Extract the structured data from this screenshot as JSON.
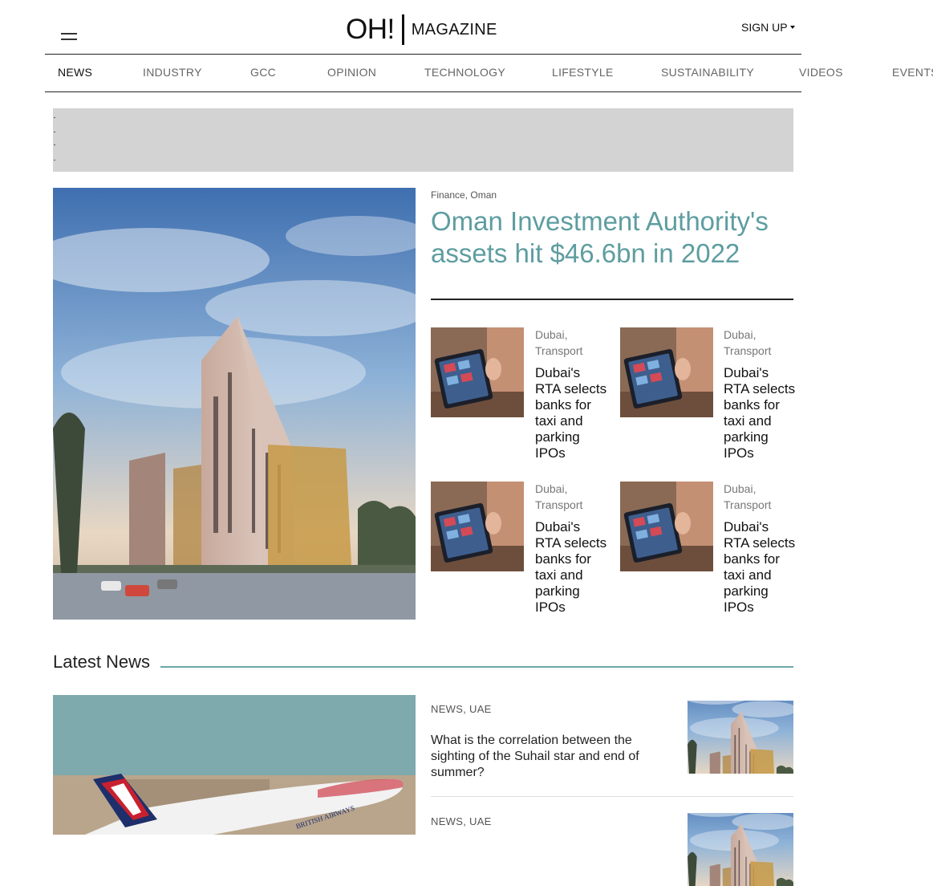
{
  "header": {
    "menu_icon": "hamburger-menu-icon",
    "logo_main": "OH!",
    "logo_sub": "MAGAZINE",
    "signup_label": "SIGN UP"
  },
  "nav": {
    "items": [
      {
        "label": "NEWS",
        "active": true
      },
      {
        "label": "INDUSTRY",
        "active": false
      },
      {
        "label": "GCC",
        "active": false
      },
      {
        "label": "OPINION",
        "active": false
      },
      {
        "label": "TECHNOLOGY",
        "active": false
      },
      {
        "label": "LIFESTYLE",
        "active": false
      },
      {
        "label": "SUSTAINABILITY",
        "active": false
      },
      {
        "label": "VIDEOS",
        "active": false
      },
      {
        "label": "EVENTS",
        "active": false
      }
    ]
  },
  "featured": {
    "category": "Finance, Oman",
    "title": "Oman Investment Authority's assets hit $46.6bn in 2022",
    "accent_color": "#5e9da0"
  },
  "cards": [
    {
      "category": "Dubai, Transport",
      "title": "Dubai's RTA selects banks for taxi and parking IPOs"
    },
    {
      "category": "Dubai, Transport",
      "title": "Dubai's RTA selects banks for taxi and parking IPOs"
    },
    {
      "category": "Dubai, Transport",
      "title": "Dubai's RTA selects banks for taxi and parking IPOs"
    },
    {
      "category": "Dubai, Transport",
      "title": "Dubai's RTA selects banks for taxi and parking IPOs"
    }
  ],
  "latest": {
    "heading": "Latest News",
    "plane_livery": "BRITISH AIRWAYS",
    "items": [
      {
        "category": "NEWS, UAE",
        "title": "What is the correlation between the sighting of the Suhail star and end of summer?"
      },
      {
        "category": "NEWS, UAE",
        "title": ""
      }
    ]
  }
}
